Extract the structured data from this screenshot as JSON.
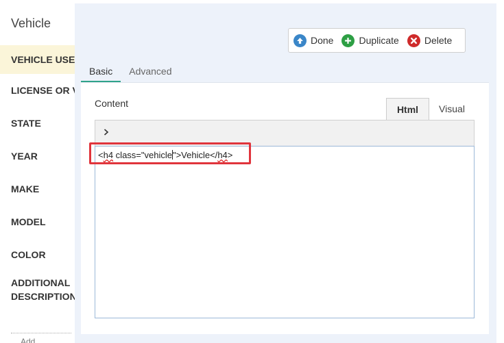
{
  "section": {
    "title": "Vehicle"
  },
  "left_fields": [
    {
      "label": "VEHICLE USE"
    },
    {
      "label": "LICENSE OR VIN"
    },
    {
      "label": "STATE"
    },
    {
      "label": "YEAR"
    },
    {
      "label": "MAKE"
    },
    {
      "label": "MODEL"
    },
    {
      "label": "COLOR"
    },
    {
      "label": "ADDITIONAL DESCRIPTION"
    }
  ],
  "left_more": "Add ...",
  "actions": {
    "done": "Done",
    "duplicate": "Duplicate",
    "delete": "Delete"
  },
  "tabs": [
    {
      "label": "Basic"
    },
    {
      "label": "Advanced"
    }
  ],
  "content": {
    "label": "Content",
    "modes": {
      "html": "Html",
      "visual": "Visual"
    },
    "code": {
      "p1": "<",
      "p2": "h4",
      "p3": " class=\"",
      "p4": "vehicle",
      "p5": "\">Vehicle</",
      "p6": "h4",
      "p7": ">"
    }
  },
  "colors": {
    "accent_tab": "#2fa38a",
    "done_icon": "#3a86c8",
    "duplicate_icon": "#2d9f44",
    "delete_icon": "#cf2b2b",
    "highlight": "#e0343c",
    "active_field_bg": "#fbf5d9"
  },
  "icons": {
    "done": "arrow-up-circle-icon",
    "duplicate": "plus-circle-icon",
    "delete": "x-circle-icon",
    "toolbar": "chevron-right-icon"
  }
}
